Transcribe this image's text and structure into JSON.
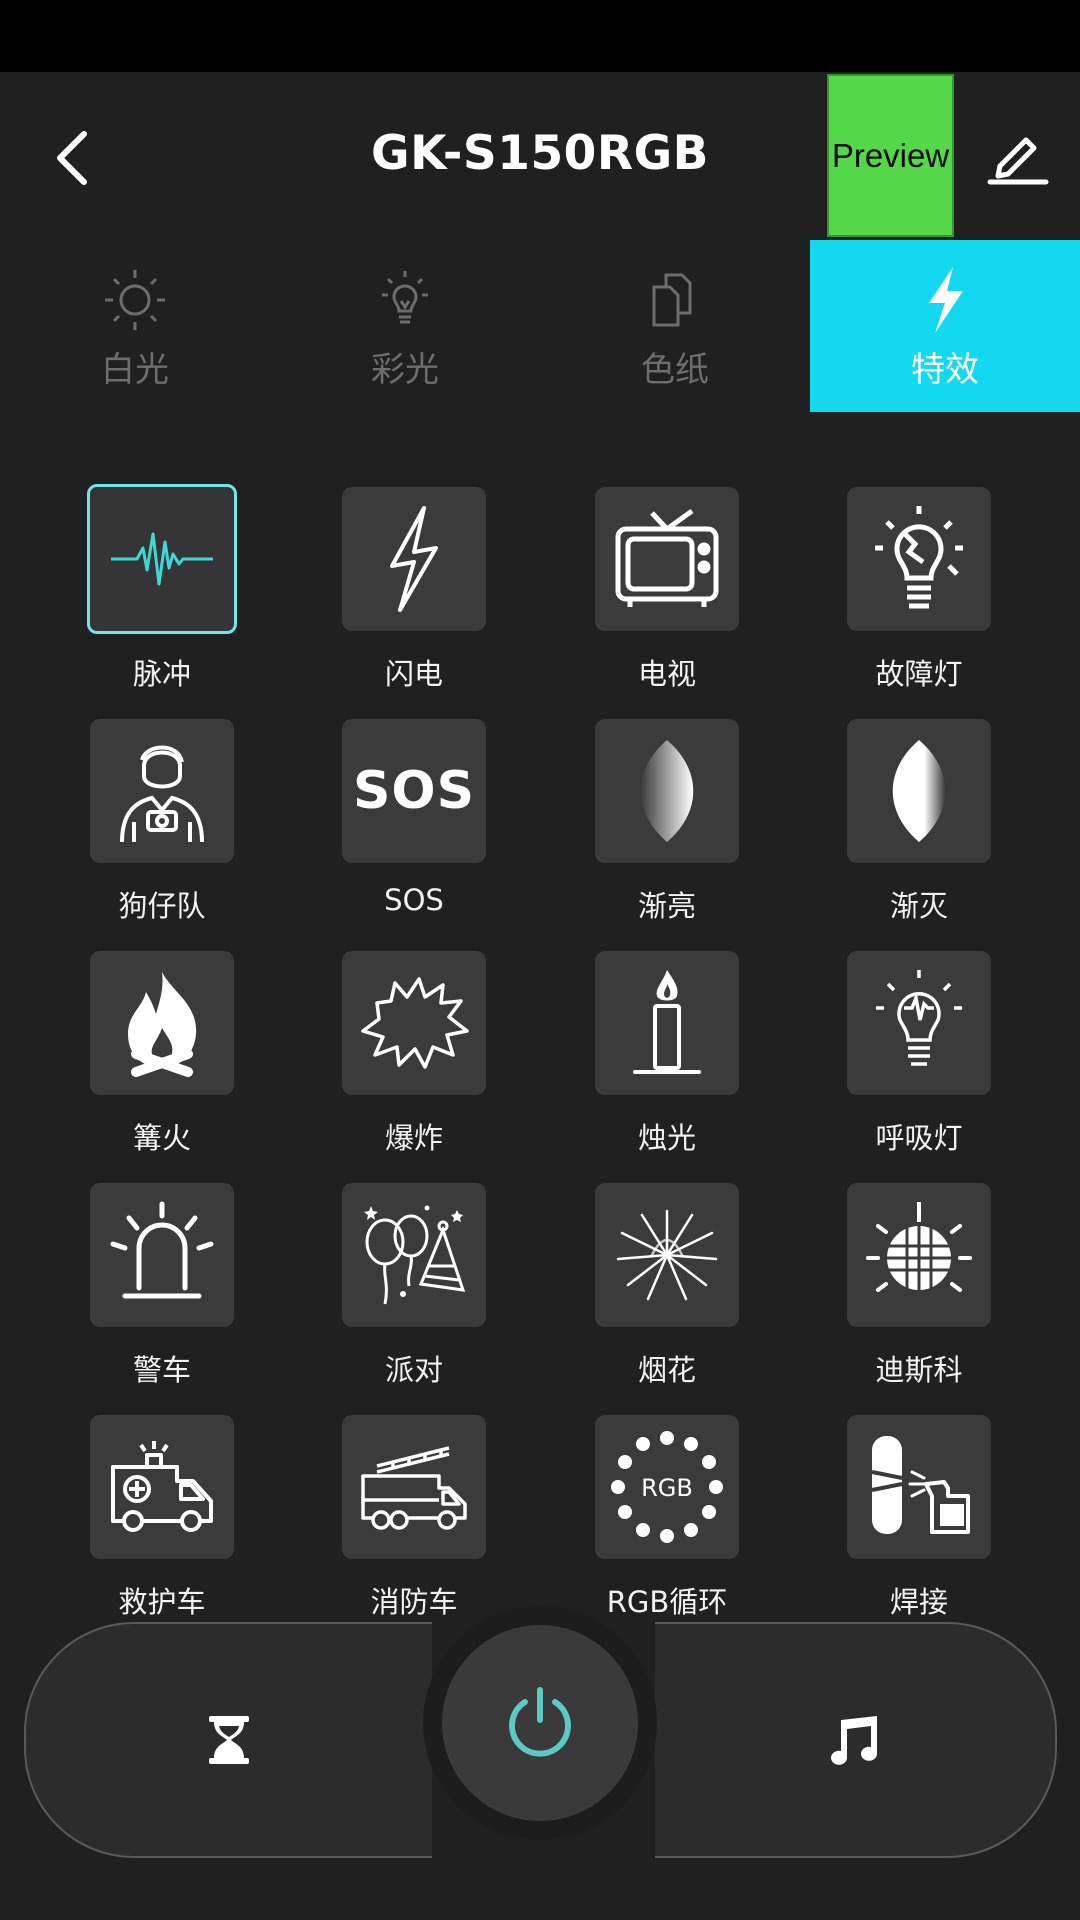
{
  "header": {
    "title": "GK-S150RGB",
    "preview_label": "Preview",
    "back_icon": "chevron-left-icon",
    "edit_icon": "edit-pencil-icon"
  },
  "modes": [
    {
      "label": "白光",
      "icon": "sun-icon",
      "active": false
    },
    {
      "label": "彩光",
      "icon": "bulb-icon",
      "active": false
    },
    {
      "label": "色纸",
      "icon": "pages-icon",
      "active": false
    },
    {
      "label": "特效",
      "icon": "lightning-icon",
      "active": true
    }
  ],
  "effects": [
    {
      "label": "脉冲",
      "icon": "pulse-icon",
      "selected": true
    },
    {
      "label": "闪电",
      "icon": "lightning-icon"
    },
    {
      "label": "电视",
      "icon": "tv-icon"
    },
    {
      "label": "故障灯",
      "icon": "broken-bulb-icon"
    },
    {
      "label": "狗仔队",
      "icon": "paparazzi-icon"
    },
    {
      "label": "SOS",
      "icon": "sos-icon"
    },
    {
      "label": "渐亮",
      "icon": "fade-in-icon"
    },
    {
      "label": "渐灭",
      "icon": "fade-out-icon"
    },
    {
      "label": "篝火",
      "icon": "campfire-icon"
    },
    {
      "label": "爆炸",
      "icon": "explosion-icon"
    },
    {
      "label": "烛光",
      "icon": "candle-icon"
    },
    {
      "label": "呼吸灯",
      "icon": "breathing-bulb-icon"
    },
    {
      "label": "警车",
      "icon": "siren-icon"
    },
    {
      "label": "派对",
      "icon": "party-icon"
    },
    {
      "label": "烟花",
      "icon": "fireworks-icon"
    },
    {
      "label": "迪斯科",
      "icon": "disco-ball-icon"
    },
    {
      "label": "救护车",
      "icon": "ambulance-icon"
    },
    {
      "label": "消防车",
      "icon": "fire-truck-icon"
    },
    {
      "label": "RGB循环",
      "icon": "rgb-cycle-icon",
      "icon_text": "RGB"
    },
    {
      "label": "焊接",
      "icon": "welding-icon"
    }
  ],
  "controls": {
    "timer_icon": "hourglass-icon",
    "power_icon": "power-icon",
    "music_icon": "music-note-icon"
  },
  "colors": {
    "accent": "#12d9f0",
    "preview_bg": "#54d84a",
    "power": "#5cc8c8",
    "background": "#202020",
    "tile": "#3b3b3b"
  }
}
